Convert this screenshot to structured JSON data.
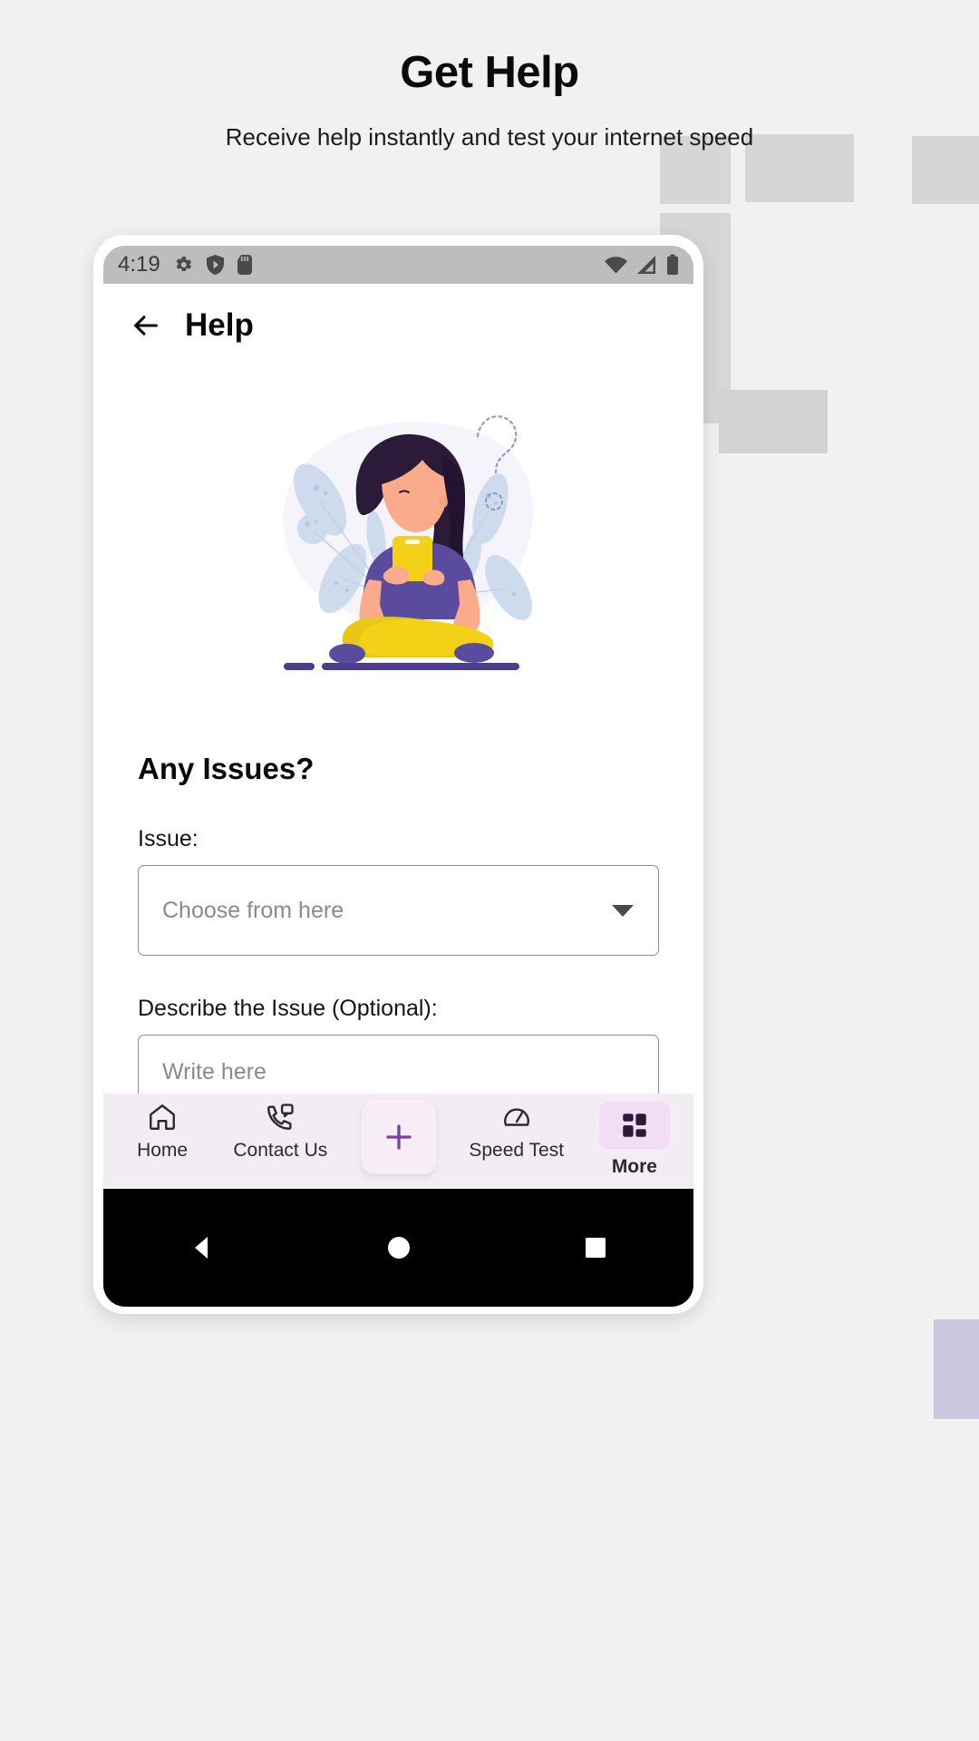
{
  "page": {
    "headline": "Get Help",
    "subhead": "Receive help instantly and test your internet speed",
    "background_color": "#f1f1f1"
  },
  "statusbar": {
    "clock": "4:19",
    "left_icons": [
      "gear-icon",
      "shield-play-icon",
      "sd-card-icon"
    ],
    "right_icons": [
      "wifi-icon",
      "cell-signal-icon",
      "battery-icon"
    ],
    "background_color": "#bdbdbd"
  },
  "appbar": {
    "back_icon": "back-arrow-icon",
    "title": "Help"
  },
  "hero": {
    "illustration": "woman-sitting-with-phone-question-marks",
    "colors": {
      "hair": "#2b1b38",
      "skin": "#f4a58a",
      "shirt": "#5b4b9e",
      "pants": "#f2d117",
      "leaf": "#c9d8ec",
      "blob": "#f5f4fa"
    }
  },
  "form": {
    "section_title": "Any Issues?",
    "issue_label": "Issue:",
    "issue_placeholder": "Choose from here",
    "issue_value": "",
    "dropdown_icon": "chevron-down-icon",
    "describe_label": "Describe the Issue (Optional):",
    "describe_placeholder": "Write here",
    "describe_value": ""
  },
  "bottomnav": {
    "background_color": "#f1edf3",
    "accent_color": "#7b3fa0",
    "pill_color": "#f3ddf5",
    "items": [
      {
        "label": "Home",
        "icon": "home-icon",
        "active": false
      },
      {
        "label": "Contact Us",
        "icon": "phone-message-icon",
        "active": false
      },
      {
        "label": "",
        "icon": "plus-icon",
        "active": false
      },
      {
        "label": "Speed Test",
        "icon": "speedometer-icon",
        "active": false
      },
      {
        "label": "More",
        "icon": "grid-icon",
        "active": true
      }
    ]
  },
  "sysnav": {
    "background_color": "#000000",
    "buttons": [
      "back-triangle-button",
      "home-circle-button",
      "recents-square-button"
    ]
  }
}
